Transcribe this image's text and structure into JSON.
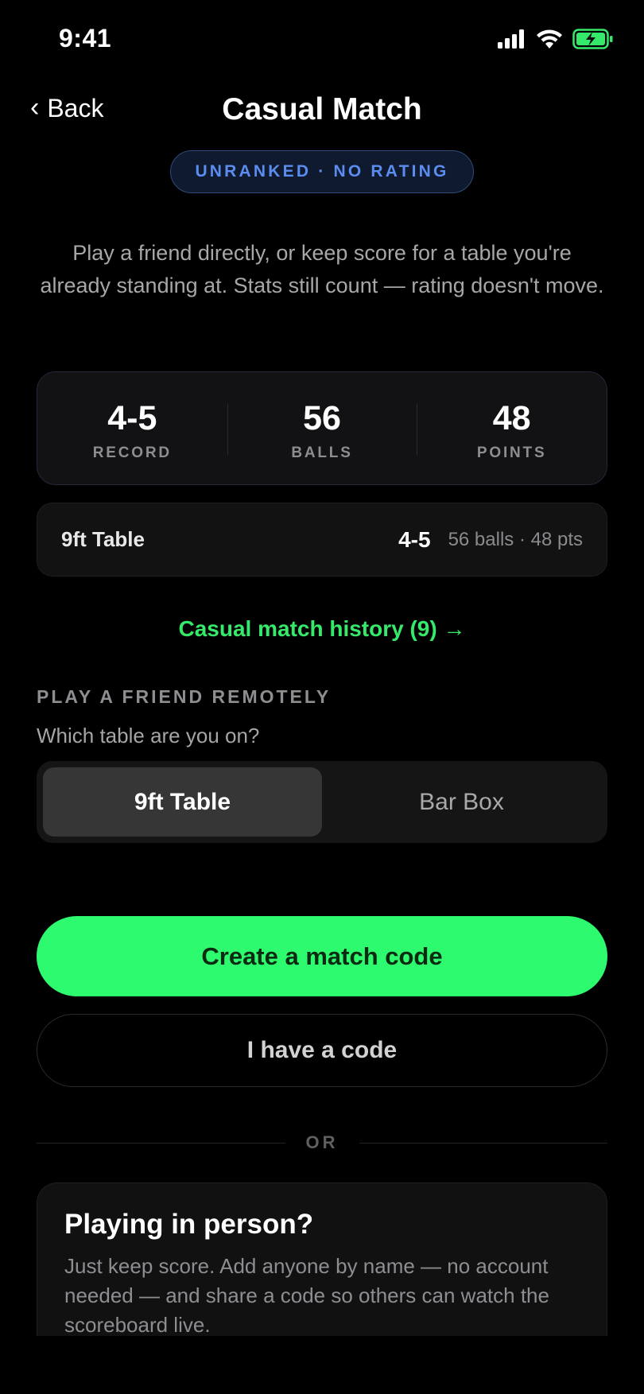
{
  "status_bar": {
    "time": "9:41",
    "icons": [
      "cellular-signal-icon",
      "wifi-icon",
      "battery-charging-icon"
    ],
    "battery_color": "#35ea6a"
  },
  "nav": {
    "back_label": "Back",
    "title": "Casual Match"
  },
  "badge": {
    "label": "UNRANKED · NO RATING"
  },
  "intro": "Play a friend directly, or keep score for a table you're already standing at. Stats still count — rating doesn't move.",
  "stats": [
    {
      "value": "4-5",
      "label": "RECORD"
    },
    {
      "value": "56",
      "label": "BALLS"
    },
    {
      "value": "48",
      "label": "POINTS"
    }
  ],
  "table_record": {
    "name": "9ft Table",
    "record": "4-5",
    "meta": "56 balls · 48 pts"
  },
  "history_link": "Casual match history (9) →",
  "remote": {
    "heading": "PLAY A FRIEND REMOTELY",
    "subheading": "Which table are you on?",
    "options": [
      "9ft Table",
      "Bar Box"
    ],
    "selected": "9ft Table"
  },
  "actions": {
    "create_code": "Create a match code",
    "have_code": "I have a code"
  },
  "divider_label": "OR",
  "in_person": {
    "title": "Playing in person?",
    "text": "Just keep score. Add anyone by name — no account needed — and share a code so others can watch the scoreboard live."
  },
  "colors": {
    "accent_green": "#2dfa6f",
    "badge_blue": "#5b8cf0",
    "background": "#000000"
  }
}
